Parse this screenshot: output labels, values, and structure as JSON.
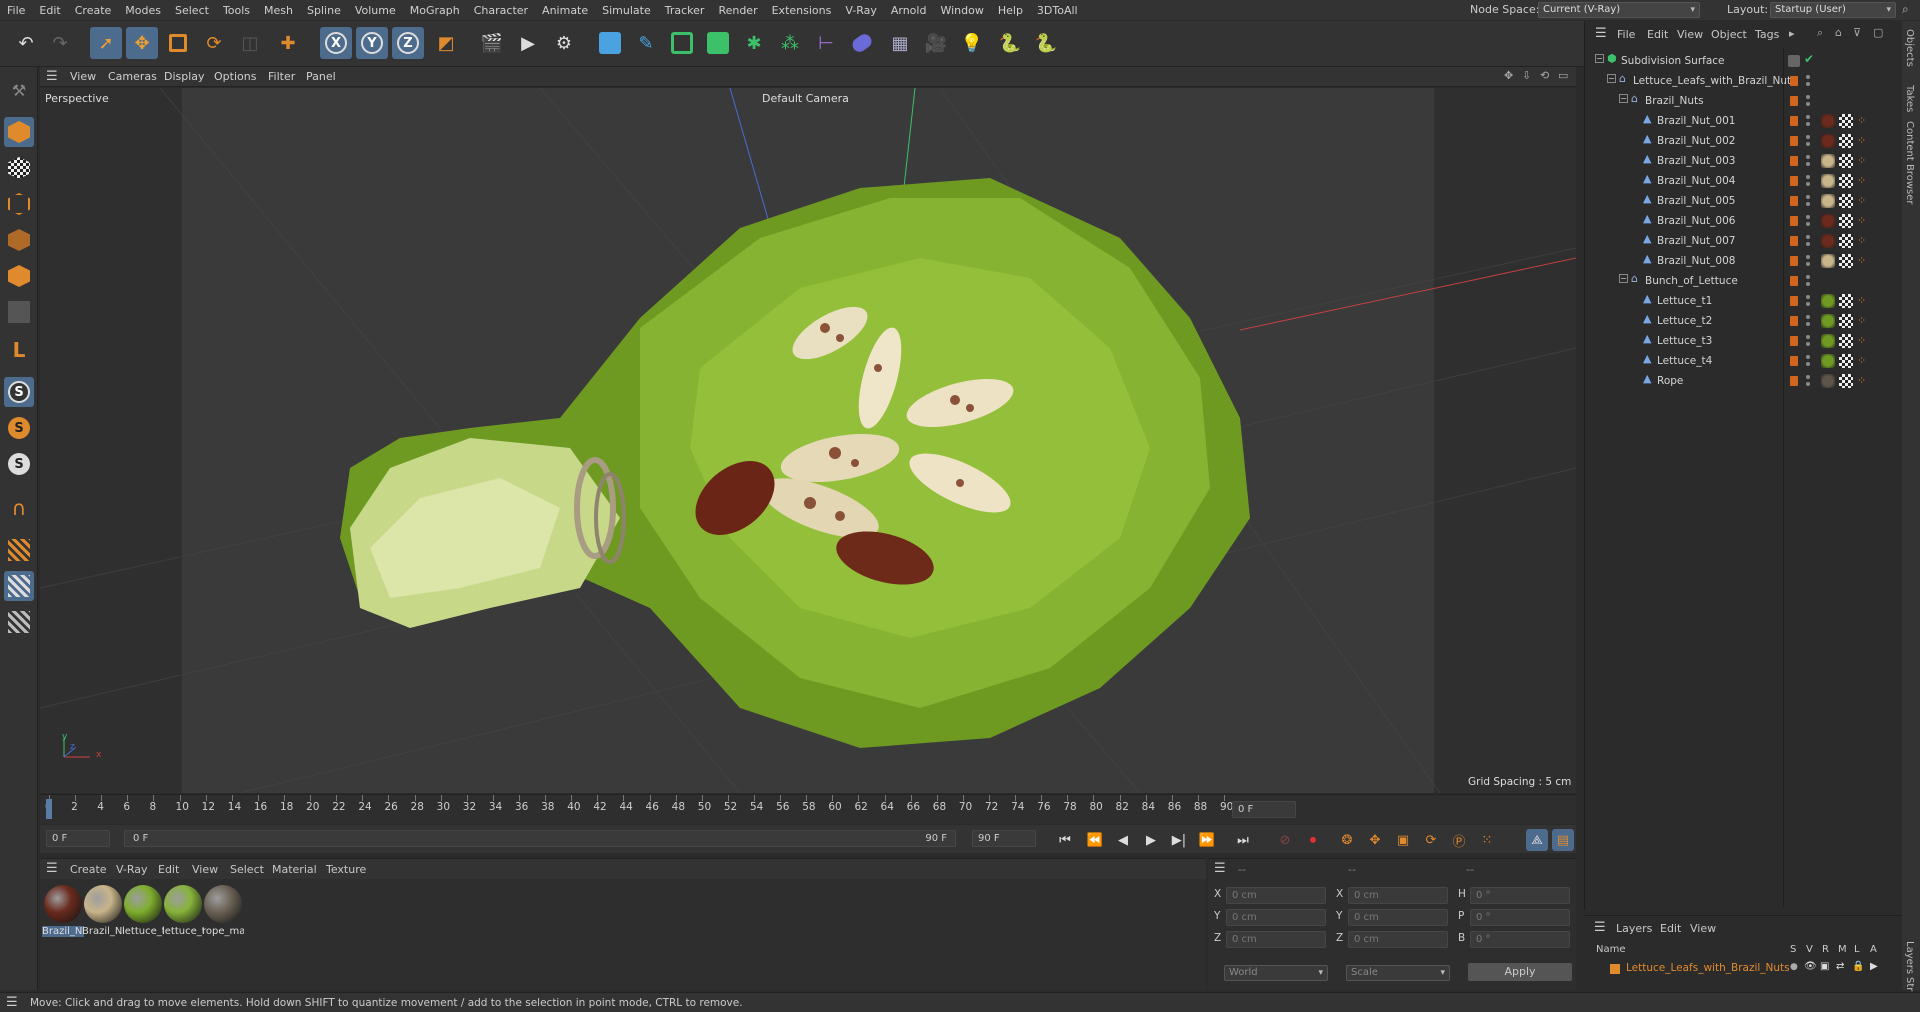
{
  "menubar": {
    "items": [
      "File",
      "Edit",
      "Create",
      "Modes",
      "Select",
      "Tools",
      "Mesh",
      "Spline",
      "Volume",
      "MoGraph",
      "Character",
      "Animate",
      "Simulate",
      "Tracker",
      "Render",
      "Extensions",
      "V-Ray",
      "Arnold",
      "Window",
      "Help",
      "3DToAll"
    ],
    "node_space_label": "Node Space:",
    "node_space_value": "Current (V-Ray)",
    "layout_label": "Layout:",
    "layout_value": "Startup (User)"
  },
  "viewport": {
    "menu": [
      "View",
      "Cameras",
      "Display",
      "Options",
      "Filter",
      "Panel"
    ],
    "view_name": "Perspective",
    "camera_name": "Default Camera",
    "grid_spacing": "Grid Spacing : 5 cm",
    "axis_x": "x",
    "axis_y": "y",
    "axis_z": "z"
  },
  "timeline": {
    "ticks": [
      "0",
      "2",
      "4",
      "6",
      "8",
      "10",
      "12",
      "14",
      "16",
      "18",
      "20",
      "22",
      "24",
      "26",
      "28",
      "30",
      "32",
      "34",
      "36",
      "38",
      "40",
      "42",
      "44",
      "46",
      "48",
      "50",
      "52",
      "54",
      "56",
      "58",
      "60",
      "62",
      "64",
      "66",
      "68",
      "70",
      "72",
      "74",
      "76",
      "78",
      "80",
      "82",
      "84",
      "86",
      "88",
      "90"
    ],
    "current_frame": "0 F",
    "start_frame": "0 F",
    "range_start": "0 F",
    "range_end": "90 F",
    "end_frame": "90 F"
  },
  "materials": {
    "menu": [
      "Create",
      "V-Ray",
      "Edit",
      "View",
      "Select",
      "Material",
      "Texture"
    ],
    "items": [
      {
        "label": "Brazil_Nu",
        "color": "#6a2a1e"
      },
      {
        "label": "Brazil_Nu",
        "color": "#c8b58a"
      },
      {
        "label": "lettuce_t",
        "color": "#7fae2e"
      },
      {
        "label": "lettuce_t",
        "color": "#86b33a"
      },
      {
        "label": "rope_ma",
        "color": "#6b6256"
      }
    ]
  },
  "attributes": {
    "col_headers": [
      "--",
      "--",
      "--"
    ],
    "rows": [
      {
        "a": "X",
        "av": "0 cm",
        "b": "X",
        "bv": "0 cm",
        "c": "H",
        "cv": "0 °"
      },
      {
        "a": "Y",
        "av": "0 cm",
        "b": "Y",
        "bv": "0 cm",
        "c": "P",
        "cv": "0 °"
      },
      {
        "a": "Z",
        "av": "0 cm",
        "b": "Z",
        "bv": "0 cm",
        "c": "B",
        "cv": "0 °"
      }
    ],
    "coord_system": "World",
    "mode": "Scale",
    "apply_label": "Apply"
  },
  "objects": {
    "menu": [
      "File",
      "Edit",
      "View",
      "Object",
      "Tags"
    ],
    "rows": [
      {
        "name": "Subdivision Surface",
        "indent": 0,
        "kind": "generator",
        "tag": "check"
      },
      {
        "name": "Lettuce_Leafs_with_Brazil_Nuts",
        "indent": 1,
        "kind": "null",
        "tag": ""
      },
      {
        "name": "Brazil_Nuts",
        "indent": 2,
        "kind": "null",
        "tag": ""
      },
      {
        "name": "Brazil_Nut_001",
        "indent": 3,
        "kind": "mesh",
        "tag": "dark"
      },
      {
        "name": "Brazil_Nut_002",
        "indent": 3,
        "kind": "mesh",
        "tag": "dark"
      },
      {
        "name": "Brazil_Nut_003",
        "indent": 3,
        "kind": "mesh",
        "tag": "light"
      },
      {
        "name": "Brazil_Nut_004",
        "indent": 3,
        "kind": "mesh",
        "tag": "light"
      },
      {
        "name": "Brazil_Nut_005",
        "indent": 3,
        "kind": "mesh",
        "tag": "light"
      },
      {
        "name": "Brazil_Nut_006",
        "indent": 3,
        "kind": "mesh",
        "tag": "dark"
      },
      {
        "name": "Brazil_Nut_007",
        "indent": 3,
        "kind": "mesh",
        "tag": "dark"
      },
      {
        "name": "Brazil_Nut_008",
        "indent": 3,
        "kind": "mesh",
        "tag": "light"
      },
      {
        "name": "Bunch_of_Lettuce",
        "indent": 2,
        "kind": "null",
        "tag": ""
      },
      {
        "name": "Lettuce_t1",
        "indent": 3,
        "kind": "mesh",
        "tag": "green"
      },
      {
        "name": "Lettuce_t2",
        "indent": 3,
        "kind": "mesh",
        "tag": "green"
      },
      {
        "name": "Lettuce_t3",
        "indent": 3,
        "kind": "mesh",
        "tag": "green"
      },
      {
        "name": "Lettuce_t4",
        "indent": 3,
        "kind": "mesh",
        "tag": "green"
      },
      {
        "name": "Rope",
        "indent": 3,
        "kind": "mesh",
        "tag": "rope"
      }
    ]
  },
  "layers": {
    "menu": [
      "Layers",
      "Edit",
      "View"
    ],
    "name_header": "Name",
    "flags": [
      "S",
      "V",
      "R",
      "M",
      "L",
      "A"
    ],
    "layer_name": "Lettuce_Leafs_with_Brazil_Nuts"
  },
  "right_tabs": [
    "Objects",
    "Takes",
    "Content Browser",
    "Layers",
    "Str"
  ],
  "status": "Move: Click and drag to move elements. Hold down SHIFT to quantize movement / add to the selection in point mode, CTRL to remove.",
  "colors": {
    "accent": "#4d6b8c",
    "object_dot": "#d2661f",
    "layer_name": "#e08a2e"
  }
}
